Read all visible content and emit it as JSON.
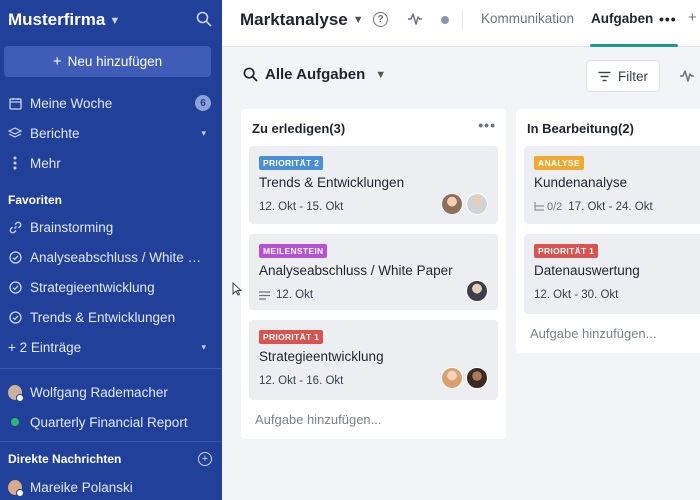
{
  "sidebar": {
    "workspace": "Musterfirma",
    "add_button": "Neu hinzufügen",
    "items": [
      {
        "label": "Meine Woche",
        "badge": "6"
      },
      {
        "label": "Berichte"
      },
      {
        "label": "Mehr"
      }
    ],
    "favorites_title": "Favoriten",
    "favorites": [
      {
        "label": "Brainstorming"
      },
      {
        "label": "Analyseabschluss / White Paper"
      },
      {
        "label": "Strategieentwicklung"
      },
      {
        "label": "Trends & Entwicklungen"
      }
    ],
    "more_entries": "+ 2 Einträge",
    "people": [
      {
        "label": "Wolfgang Rademacher"
      },
      {
        "label": "Quarterly Financial Report"
      }
    ],
    "dm_title": "Direkte Nachrichten",
    "dm": [
      {
        "label": "Mareike Polanski"
      }
    ]
  },
  "header": {
    "title": "Marktanalyse",
    "tabs": [
      {
        "label": "Kommunikation"
      },
      {
        "label": "Aufgaben"
      }
    ],
    "more": "•••",
    "add": "+"
  },
  "toolbar": {
    "title": "Alle Aufgaben",
    "filter": "Filter"
  },
  "columns": [
    {
      "title": "Zu erledigen(3)",
      "more": "•••",
      "cards": [
        {
          "badge": "PRIORITÄT 2",
          "badge_color": "#4a8fd6",
          "title": "Trends & Entwicklungen",
          "date": "12. Okt - 15. Okt"
        },
        {
          "badge": "MEILENSTEIN",
          "badge_color": "#b651d6",
          "title": "Analyseabschluss / White Paper",
          "date": "12. Okt"
        },
        {
          "badge": "PRIORITÄT 1",
          "badge_color": "#d9534f",
          "title": "Strategieentwicklung",
          "date": "12. Okt - 16. Okt"
        }
      ],
      "add_task": "Aufgabe hinzufügen..."
    },
    {
      "title": "In Bearbeitung(2)",
      "cards": [
        {
          "badge": "ANALYSE",
          "badge_color": "#f0a830",
          "title": "Kundenanalyse",
          "subtasks": "0/2",
          "date": "17. Okt - 24. Okt"
        },
        {
          "badge": "PRIORITÄT 1",
          "badge_color": "#d9534f",
          "title": "Datenauswertung",
          "date": "12. Okt - 30. Okt"
        }
      ],
      "add_task": "Aufgabe hinzufügen..."
    }
  ]
}
